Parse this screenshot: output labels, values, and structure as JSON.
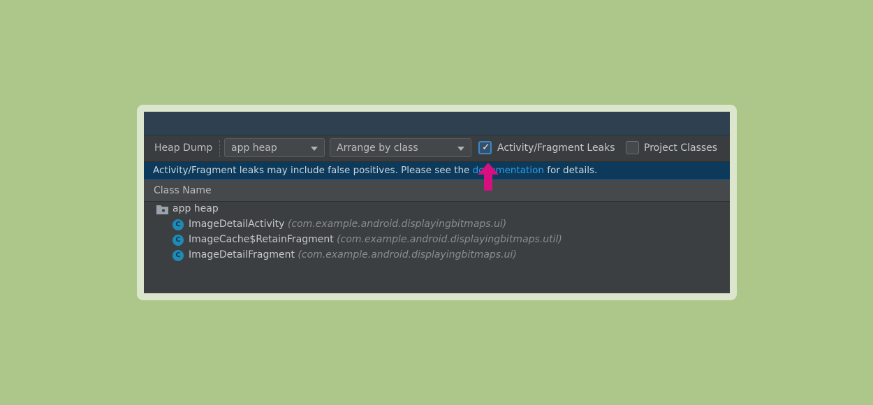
{
  "toolbar": {
    "label": "Heap Dump",
    "heap_select": "app heap",
    "arrange_select": "Arrange by class",
    "leaks_checkbox": {
      "label": "Activity/Fragment Leaks",
      "checked": true
    },
    "project_checkbox": {
      "label": "Project Classes",
      "checked": false
    }
  },
  "banner": {
    "text_before": "Activity/Fragment leaks may include false positives. Please see the ",
    "link": "documentation",
    "text_after": " for details."
  },
  "table": {
    "column": "Class Name",
    "root": {
      "label": "app heap",
      "icon": "folder-icon"
    },
    "rows": [
      {
        "name": "ImageDetailActivity",
        "package": "(com.example.android.displayingbitmaps.ui)",
        "icon": "class-icon",
        "icon_letter": "C"
      },
      {
        "name": "ImageCache$RetainFragment",
        "package": "(com.example.android.displayingbitmaps.util)",
        "icon": "class-icon",
        "icon_letter": "C"
      },
      {
        "name": "ImageDetailFragment",
        "package": "(com.example.android.displayingbitmaps.ui)",
        "icon": "class-icon",
        "icon_letter": "C"
      }
    ]
  },
  "annotation": {
    "icon": "arrow-up-icon",
    "color": "#d6117f"
  },
  "colors": {
    "background": "#adc68a",
    "banner": "#0d3a5a",
    "link": "#2f9be6",
    "class_icon": "#1f8bb5"
  }
}
